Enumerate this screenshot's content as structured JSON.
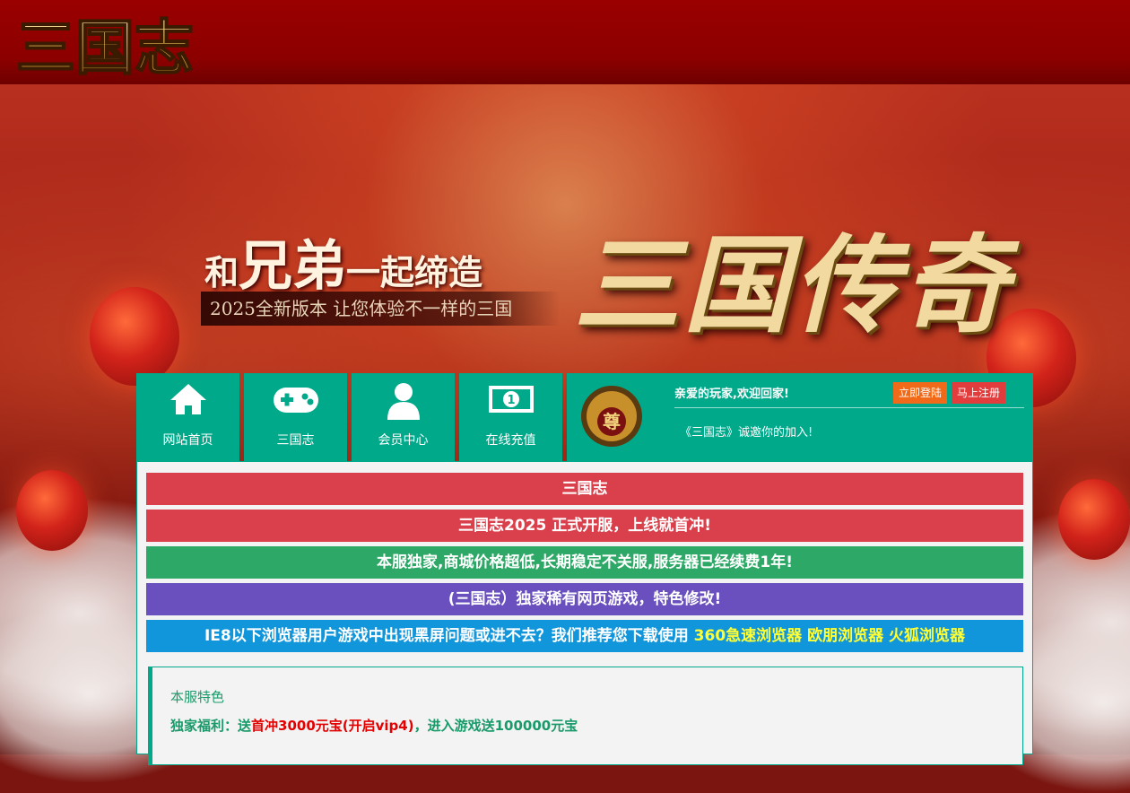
{
  "header": {
    "logo_text": "三国志"
  },
  "banner": {
    "slogan_small_1": "和",
    "slogan_big": "兄弟",
    "slogan_small_2": "一起缔造",
    "subtitle": "2025全新版本  让您体验不一样的三国",
    "title": "三国传奇"
  },
  "nav": {
    "items": [
      {
        "label": "网站首页",
        "icon": "home-icon"
      },
      {
        "label": "三国志",
        "icon": "gamepad-icon"
      },
      {
        "label": "会员中心",
        "icon": "user-icon"
      },
      {
        "label": "在线充值",
        "icon": "money-icon"
      }
    ]
  },
  "account": {
    "badge_text": "尊",
    "welcome": "亲爱的玩家,欢迎回家!",
    "login_label": "立即登陆",
    "register_label": "马上注册",
    "invite": "《三国志》诚邀你的加入!"
  },
  "notices": [
    {
      "text": "三国志",
      "color": "#d9404b"
    },
    {
      "text": "三国志2025 正式开服，上线就首冲!",
      "color": "#d9404b"
    },
    {
      "text": "本服独家,商城价格超低,长期稳定不关服,服务器已经续费1年!",
      "color": "#2da866"
    },
    {
      "text": "(三国志）独家稀有网页游戏，特色修改!",
      "color": "#6a4fbf"
    }
  ],
  "browser_notice": {
    "text": "IE8以下浏览器用户游戏中出现黑屏问题或进不去？我们推荐您下载使用 ",
    "links": [
      "360急速浏览器",
      "欧朋浏览器",
      "火狐浏览器"
    ],
    "color": "#1296db"
  },
  "features": {
    "title": "本服特色",
    "line_prefix": "独家福利：送",
    "line_highlight": "首冲3000元宝(开启vip4)",
    "line_suffix": "，进入游戏送100000元宝"
  }
}
